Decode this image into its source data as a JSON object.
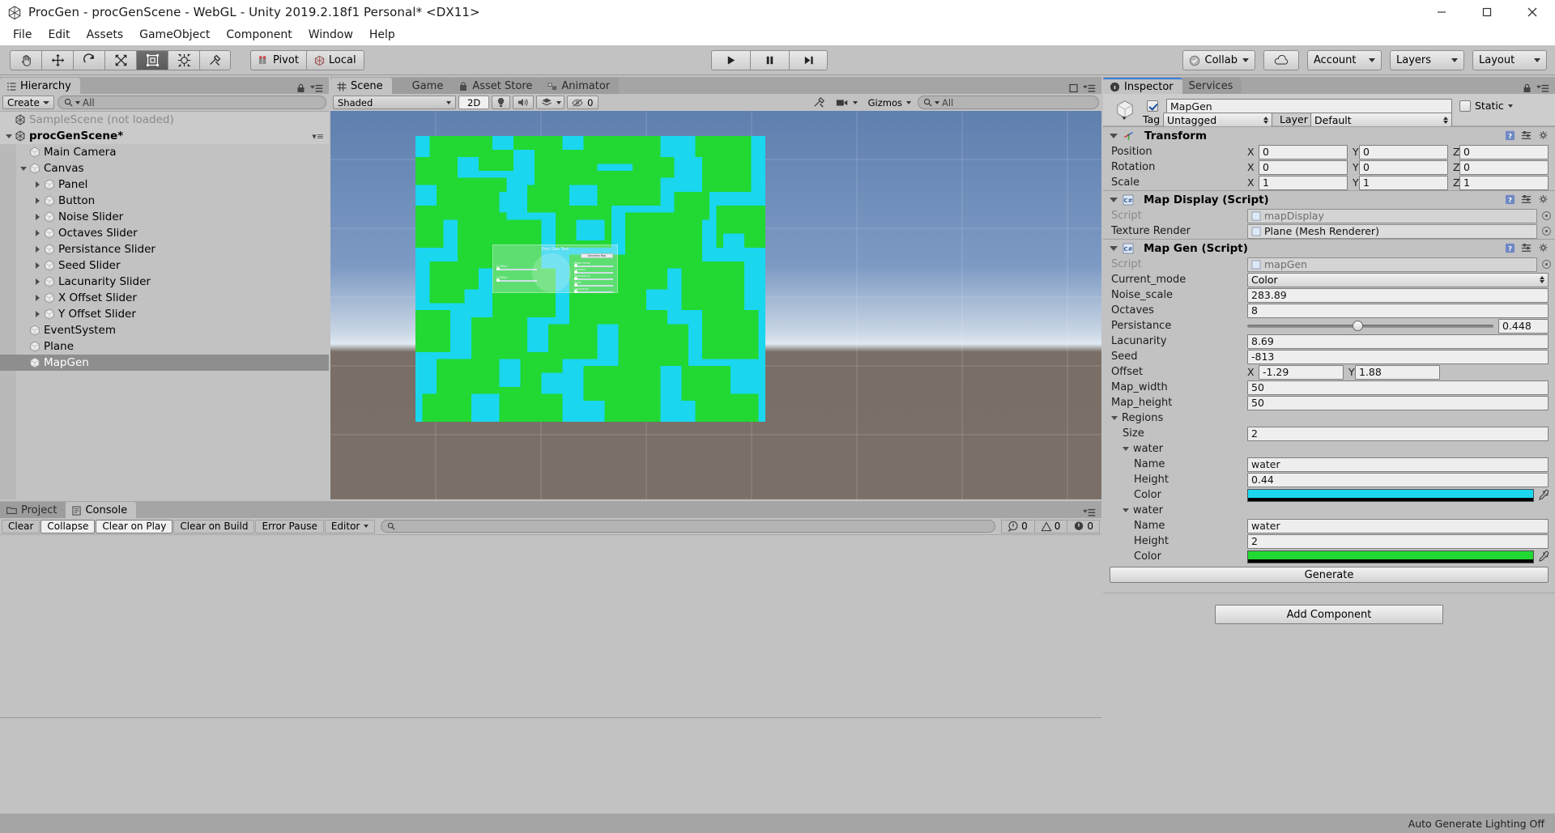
{
  "window": {
    "title": "ProcGen - procGenScene - WebGL - Unity 2019.2.18f1 Personal* <DX11>",
    "minimize_label": "minimize-icon",
    "maximize_label": "maximize-icon",
    "close_label": "close-icon"
  },
  "menubar": {
    "items": [
      "File",
      "Edit",
      "Assets",
      "GameObject",
      "Component",
      "Window",
      "Help"
    ]
  },
  "toolbar": {
    "tools": [
      {
        "name": "hand-tool",
        "active": false
      },
      {
        "name": "move-tool",
        "active": false
      },
      {
        "name": "rotate-tool",
        "active": false
      },
      {
        "name": "scale-tool",
        "active": false
      },
      {
        "name": "rect-tool",
        "active": true
      },
      {
        "name": "transform-tool",
        "active": false
      },
      {
        "name": "custom-tool",
        "active": false
      }
    ],
    "pivot_label": "Pivot",
    "local_label": "Local",
    "play_label": "play-icon",
    "pause_label": "pause-icon",
    "step_label": "step-icon",
    "collab_label": "Collab",
    "cloud_label": "cloud-icon",
    "account_label": "Account",
    "layers_label": "Layers",
    "layout_label": "Layout"
  },
  "hierarchy": {
    "tab_label": "Hierarchy",
    "create_label": "Create",
    "search_placeholder": "All",
    "rows": [
      {
        "label": "SampleScene (not loaded)",
        "indent": 0,
        "twisty": "none",
        "icon": "unity-scene-icon",
        "dim": true,
        "bold": false,
        "selected": false,
        "options": ""
      },
      {
        "label": "procGenScene*",
        "indent": 0,
        "twisty": "open",
        "icon": "unity-scene-icon",
        "dim": false,
        "bold": true,
        "selected": false,
        "options": "▾≡"
      },
      {
        "label": "Main Camera",
        "indent": 1,
        "twisty": "none",
        "icon": "gameobject-icon",
        "dim": false,
        "bold": false,
        "selected": false,
        "options": ""
      },
      {
        "label": "Canvas",
        "indent": 1,
        "twisty": "open",
        "icon": "gameobject-icon",
        "dim": false,
        "bold": false,
        "selected": false,
        "options": ""
      },
      {
        "label": "Panel",
        "indent": 2,
        "twisty": "closed",
        "icon": "gameobject-icon",
        "dim": false,
        "bold": false,
        "selected": false,
        "options": ""
      },
      {
        "label": "Button",
        "indent": 2,
        "twisty": "closed",
        "icon": "gameobject-icon",
        "dim": false,
        "bold": false,
        "selected": false,
        "options": ""
      },
      {
        "label": "Noise Slider",
        "indent": 2,
        "twisty": "closed",
        "icon": "gameobject-icon",
        "dim": false,
        "bold": false,
        "selected": false,
        "options": ""
      },
      {
        "label": "Octaves Slider",
        "indent": 2,
        "twisty": "closed",
        "icon": "gameobject-icon",
        "dim": false,
        "bold": false,
        "selected": false,
        "options": ""
      },
      {
        "label": "Persistance Slider",
        "indent": 2,
        "twisty": "closed",
        "icon": "gameobject-icon",
        "dim": false,
        "bold": false,
        "selected": false,
        "options": ""
      },
      {
        "label": "Seed Slider",
        "indent": 2,
        "twisty": "closed",
        "icon": "gameobject-icon",
        "dim": false,
        "bold": false,
        "selected": false,
        "options": ""
      },
      {
        "label": "Lacunarity Slider",
        "indent": 2,
        "twisty": "closed",
        "icon": "gameobject-icon",
        "dim": false,
        "bold": false,
        "selected": false,
        "options": ""
      },
      {
        "label": "X Offset Slider",
        "indent": 2,
        "twisty": "closed",
        "icon": "gameobject-icon",
        "dim": false,
        "bold": false,
        "selected": false,
        "options": ""
      },
      {
        "label": "Y Offset Slider",
        "indent": 2,
        "twisty": "closed",
        "icon": "gameobject-icon",
        "dim": false,
        "bold": false,
        "selected": false,
        "options": ""
      },
      {
        "label": "EventSystem",
        "indent": 1,
        "twisty": "none",
        "icon": "gameobject-icon",
        "dim": false,
        "bold": false,
        "selected": false,
        "options": ""
      },
      {
        "label": "Plane",
        "indent": 1,
        "twisty": "none",
        "icon": "gameobject-icon",
        "dim": false,
        "bold": false,
        "selected": false,
        "options": ""
      },
      {
        "label": "MapGen",
        "indent": 1,
        "twisty": "none",
        "icon": "gameobject-icon",
        "dim": false,
        "bold": false,
        "selected": true,
        "options": ""
      }
    ]
  },
  "scene": {
    "tabs": [
      {
        "label": "Scene",
        "icon": "grid-icon",
        "active": true
      },
      {
        "label": "Game",
        "icon": "gamepad-icon",
        "active": false
      },
      {
        "label": "Asset Store",
        "icon": "store-icon",
        "active": false
      },
      {
        "label": "Animator",
        "icon": "animator-icon",
        "active": false
      }
    ],
    "shading_mode": "Shaded",
    "mode_2d": "2D",
    "lighting_icon": "lightbulb-icon",
    "audio_icon": "speaker-icon",
    "fx_icon": "fx-icon",
    "visibility_icon": "eye-off-icon",
    "visibility_count": "0",
    "tools_icon": "scene-tools-icon",
    "camera_icon": "camera-icon",
    "gizmos_label": "Gizmos",
    "search_placeholder": "All",
    "canvas_overlay": {
      "title": "Proc Gen Tool",
      "generate_button": "Generate Map",
      "sliders": [
        {
          "label": "Noise Scale"
        },
        {
          "label": "Octaves"
        },
        {
          "label": "Persistance"
        },
        {
          "label": "Seed"
        },
        {
          "label": "Lacunarity"
        },
        {
          "label": "X Offset"
        },
        {
          "label": "Y Offset"
        }
      ]
    }
  },
  "inspector": {
    "tabs": [
      {
        "label": "Inspector",
        "active": true
      },
      {
        "label": "Services",
        "active": false
      }
    ],
    "object_name": "MapGen",
    "object_enabled": true,
    "static_label": "Static",
    "tag_label": "Tag",
    "tag_value": "Untagged",
    "layer_label": "Layer",
    "layer_value": "Default",
    "components": [
      {
        "title": "Transform",
        "icon": "transform-icon",
        "rows": [
          {
            "type": "vec3",
            "label": "Position",
            "x": "0",
            "y": "0",
            "z": "0"
          },
          {
            "type": "vec3",
            "label": "Rotation",
            "x": "0",
            "y": "0",
            "z": "0"
          },
          {
            "type": "vec3",
            "label": "Scale",
            "x": "1",
            "y": "1",
            "z": "1"
          }
        ]
      },
      {
        "title": "Map Display (Script)",
        "icon": "cs-script-icon",
        "rows": [
          {
            "type": "object",
            "label": "Script",
            "value": "mapDisplay",
            "muted": true
          },
          {
            "type": "object",
            "label": "Texture Render",
            "value": "Plane (Mesh Renderer)",
            "muted": false
          }
        ]
      },
      {
        "title": "Map Gen (Script)",
        "icon": "cs-script-icon",
        "rows": [
          {
            "type": "object",
            "label": "Script",
            "value": "mapGen",
            "muted": true
          },
          {
            "type": "dropdown",
            "label": "Current_mode",
            "value": "Color"
          },
          {
            "type": "text",
            "label": "Noise_scale",
            "value": "283.89"
          },
          {
            "type": "text",
            "label": "Octaves",
            "value": "8"
          },
          {
            "type": "slider",
            "label": "Persistance",
            "value": "0.448",
            "percent": 44.8
          },
          {
            "type": "text",
            "label": "Lacunarity",
            "value": "8.69"
          },
          {
            "type": "text",
            "label": "Seed",
            "value": "-813"
          },
          {
            "type": "vec2",
            "label": "Offset",
            "x": "-1.29",
            "y": "1.88"
          },
          {
            "type": "text",
            "label": "Map_width",
            "value": "50"
          },
          {
            "type": "text",
            "label": "Map_height",
            "value": "50"
          },
          {
            "type": "foldout",
            "label": "Regions",
            "indent": 0
          },
          {
            "type": "text",
            "label": "Size",
            "value": "2",
            "indent": 1
          },
          {
            "type": "foldout",
            "label": "water",
            "indent": 1
          },
          {
            "type": "text",
            "label": "Name",
            "value": "water",
            "indent": 2
          },
          {
            "type": "text",
            "label": "Height",
            "value": "0.44",
            "indent": 2
          },
          {
            "type": "color",
            "label": "Color",
            "value": "#1ad6ef",
            "indent": 2
          },
          {
            "type": "foldout",
            "label": "water",
            "indent": 1
          },
          {
            "type": "text",
            "label": "Name",
            "value": "water",
            "indent": 2
          },
          {
            "type": "text",
            "label": "Height",
            "value": "2",
            "indent": 2
          },
          {
            "type": "color",
            "label": "Color",
            "value": "#22d833",
            "indent": 2
          }
        ],
        "action_button": "Generate"
      }
    ],
    "add_component_label": "Add Component"
  },
  "console": {
    "tabs": [
      {
        "label": "Project",
        "icon": "folder-icon",
        "active": false
      },
      {
        "label": "Console",
        "icon": "console-icon",
        "active": true
      }
    ],
    "buttons": [
      {
        "label": "Clear",
        "pressed": false
      },
      {
        "label": "Collapse",
        "pressed": true
      },
      {
        "label": "Clear on Play",
        "pressed": true
      },
      {
        "label": "Clear on Build",
        "pressed": false
      },
      {
        "label": "Error Pause",
        "pressed": false
      },
      {
        "label": "Editor",
        "pressed": false,
        "dropdown": true
      }
    ],
    "search_placeholder": "",
    "counts": {
      "info": "0",
      "warning": "0",
      "error": "0"
    },
    "messages": []
  },
  "statusbar": {
    "text": "Auto Generate Lighting Off"
  },
  "colors": {
    "water_color": "#1ad6ef",
    "land_color": "#22d833",
    "accent_blue": "#3b7dd8",
    "panel_bg": "#c2c2c2",
    "window_bg": "#a5a5a5"
  }
}
